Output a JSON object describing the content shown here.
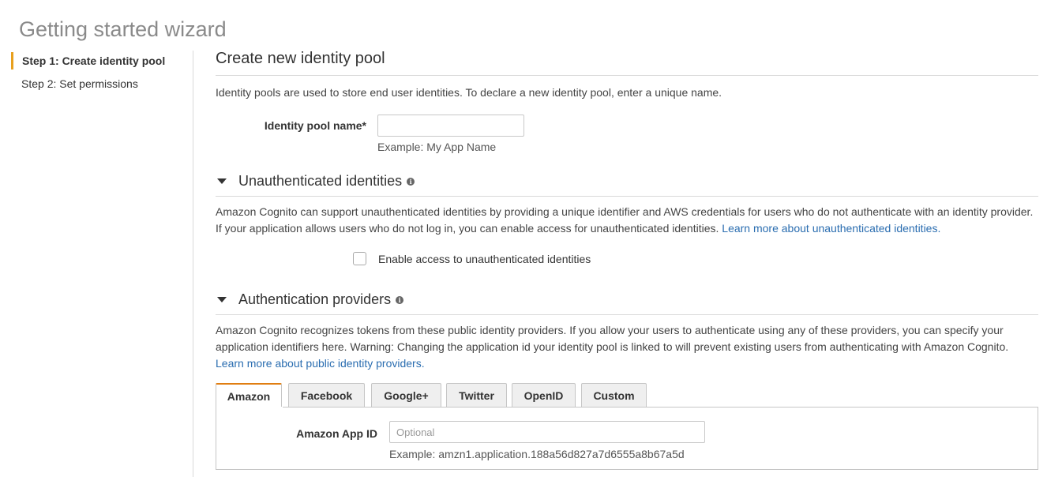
{
  "page": {
    "title": "Getting started wizard"
  },
  "steps": [
    {
      "label": "Step 1: Create identity pool",
      "active": true
    },
    {
      "label": "Step 2: Set permissions",
      "active": false
    }
  ],
  "create": {
    "title": "Create new identity pool",
    "description": "Identity pools are used to store end user identities. To declare a new identity pool, enter a unique name.",
    "pool_name_label": "Identity pool name*",
    "pool_name_value": "",
    "pool_name_hint": "Example: My App Name"
  },
  "unauth": {
    "title": "Unauthenticated identities",
    "info_icon": "info-icon",
    "description": "Amazon Cognito can support unauthenticated identities by providing a unique identifier and AWS credentials for users who do not authenticate with an identity provider. If your application allows users who do not log in, you can enable access for unauthenticated identities.",
    "learn_more": "Learn more about unauthenticated identities.",
    "checkbox_label": "Enable access to unauthenticated identities",
    "checked": false
  },
  "auth": {
    "title": "Authentication providers",
    "description": "Amazon Cognito recognizes tokens from these public identity providers. If you allow your users to authenticate using any of these providers, you can specify your application identifiers here. Warning: Changing the application id your identity pool is linked to will prevent existing users from authenticating with Amazon Cognito.",
    "learn_more": "Learn more about public identity providers.",
    "tabs": [
      "Amazon",
      "Facebook",
      "Google+",
      "Twitter",
      "OpenID",
      "Custom"
    ],
    "active_tab": "Amazon",
    "amazon_app_id_label": "Amazon App ID",
    "amazon_app_id_placeholder": "Optional",
    "amazon_app_id_hint": "Example: amzn1.application.188a56d827a7d6555a8b67a5d"
  },
  "colors": {
    "accent": "#e8a01e",
    "link": "#2a6db0",
    "tab_active_border": "#e07e12"
  }
}
